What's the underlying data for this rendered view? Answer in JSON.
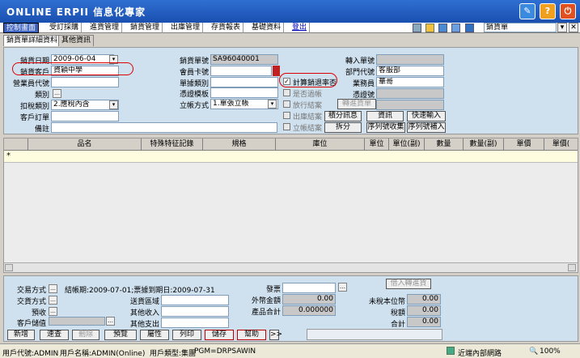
{
  "app": {
    "title": "ONLINE ERPII 信息化專家",
    "window_select": "銷貨單",
    "colors": {
      "titlebar": "#2f6fd2",
      "panel": "#cfe0ee",
      "active_menu": "#3a60c0"
    }
  },
  "menu": {
    "items": [
      "控制畫面",
      "受訂採購",
      "進貨管理",
      "銷貨管理",
      "出庫管理",
      "存貨報表",
      "基礎資料",
      "登出"
    ]
  },
  "tabs": [
    "銷貨單詳細資料",
    "其他資訊"
  ],
  "header": {
    "sale_date_label": "銷貨日期",
    "sale_date": "2009-06-04",
    "customer_label": "銷貨客戶",
    "customer": "資穎中學",
    "sales_rep_code_label": "營業員代號",
    "category_label": "類別",
    "tax_type_label": "扣稅類別",
    "tax_type": "2.應稅內含",
    "customer_order_label": "客戶訂單",
    "remark_label": "備註",
    "sale_no_label": "銷貨單號",
    "sale_no": "SA96040001",
    "member_card_label": "會員卡號",
    "doc_type_label": "單據類別",
    "invoice_format_label": "憑證模板",
    "account_method_label": "立帳方式",
    "account_method": "1.單張立帳",
    "calc_return_label": "計算銷退率否",
    "posted_label": "是否過帳",
    "release_close_label": "放行結案",
    "release_close2_label": "出庫結案",
    "ar_close_label": "立帳結案",
    "transfer_button": "轉進貨單",
    "transfer_in_label": "轉入單號",
    "dept_code_label": "部門代號",
    "dept_code": "客服部",
    "salesperson_label": "業務員",
    "salesperson": "華哥",
    "voucher_no_label": "憑證號",
    "btn_detail": "積分訊息",
    "btn_info": "資訊",
    "btn_quick_input": "快速輸入",
    "btn_split": "拆分",
    "btn_serial_collect": "序列號收集",
    "btn_serial_input": "序列號補入"
  },
  "grid": {
    "columns": [
      "品名",
      "特殊特征記錄",
      "規格",
      "庫位",
      "單位",
      "單位(副)",
      "數量",
      "數量(副)",
      "單價",
      "單價("
    ],
    "row_marker": "*"
  },
  "footer": {
    "trade_method_label": "交易方式",
    "trade_method2_label": "交貨方式",
    "receipt_label": "預收",
    "customer_stored_label": "客戶儲值",
    "info_text": "結帳期:2009-07-01;票據到期日:2009-07-31",
    "delivery_area_label": "送貨區域",
    "other_income_label": "其他收入",
    "other_expense_label": "其他支出",
    "invoice_label": "發票",
    "foreign_amount_label": "外幣金額",
    "foreign_amount": "0.00",
    "product_total_label": "產品合計",
    "product_total": "0.000000",
    "transfer_invoice_button": "借入轉進貨",
    "untaxed_label": "未稅本位幣",
    "untaxed": "0.00",
    "tax_label": "稅額",
    "tax": "0.00",
    "total_label": "合計",
    "total": "0.00"
  },
  "toolbar": {
    "new": "新增",
    "quick_check": "速查",
    "delete": "刪除",
    "preview": "預覽",
    "properties": "屬性",
    "print": "列印",
    "save": "儲存",
    "help": "幫助",
    "more": ">>"
  },
  "status": {
    "user_code": "用戶代號:ADMIN",
    "user_name": "用戶名稱:ADMIN(Online)",
    "user_type": "用戶類型:集團",
    "pgm": "PGM=DRPSAWIN",
    "network": "近端內部網路",
    "zoom": "100%"
  }
}
